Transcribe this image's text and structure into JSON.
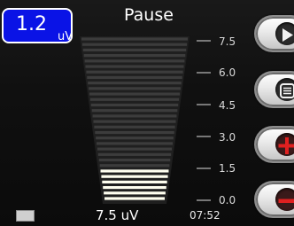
{
  "badge": {
    "value": "1.2",
    "unit": "uV"
  },
  "title": "Pause",
  "scale": {
    "labels": [
      "7.5",
      "6.0",
      "4.5",
      "3.0",
      "1.5",
      "0.0"
    ]
  },
  "level": {
    "max": 7.5,
    "current": 1.2
  },
  "status": {
    "value": "7.5 uV",
    "time": "07:52"
  },
  "buttons": [
    {
      "name": "play-button",
      "icon": "play-icon"
    },
    {
      "name": "menu-button",
      "icon": "list-icon"
    },
    {
      "name": "increase-button",
      "icon": "plus-icon"
    },
    {
      "name": "decrease-button",
      "icon": "minus-icon"
    }
  ],
  "colors": {
    "badge_bg": "#0a13e6",
    "active_bar": "#fffff0",
    "inactive_bar": "#3c3c3c"
  }
}
